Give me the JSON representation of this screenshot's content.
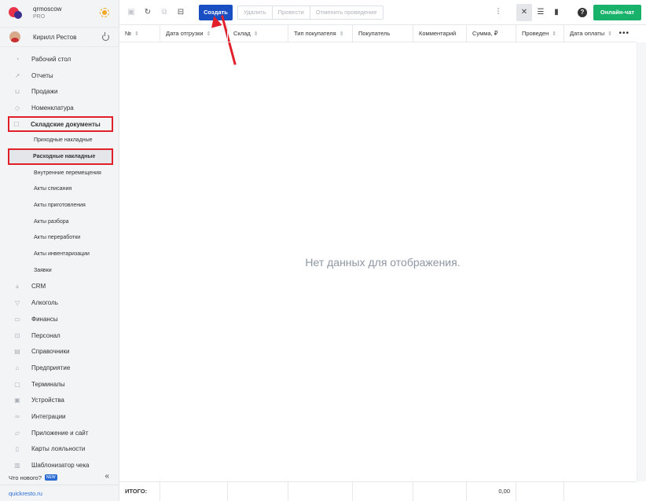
{
  "brand": {
    "name": "qrmoscow",
    "plan": "PRO"
  },
  "user": {
    "name": "Кирилл Рестов"
  },
  "sidebar": {
    "items": [
      {
        "label": "Рабочий стол",
        "icon": "gauge-icon"
      },
      {
        "label": "Отчеты",
        "icon": "chart-icon"
      },
      {
        "label": "Продажи",
        "icon": "basket-icon"
      },
      {
        "label": "Номенклатура",
        "icon": "tag-icon"
      },
      {
        "label": "Складские документы",
        "icon": "box-icon"
      }
    ],
    "sub_items": [
      "Приходные накладные",
      "Расходные накладные",
      "Внутренние перемещения",
      "Акты списания",
      "Акты приготовления",
      "Акты разбора",
      "Акты переработки",
      "Акты инвентаризации",
      "Заявки"
    ],
    "items2": [
      {
        "label": "CRM",
        "icon": "crm-icon"
      },
      {
        "label": "Алкоголь",
        "icon": "glass-icon"
      },
      {
        "label": "Финансы",
        "icon": "wallet-icon"
      },
      {
        "label": "Персонал",
        "icon": "people-icon"
      },
      {
        "label": "Справочники",
        "icon": "book-icon"
      },
      {
        "label": "Предприятие",
        "icon": "store-icon"
      },
      {
        "label": "Терминалы",
        "icon": "terminal-icon"
      },
      {
        "label": "Устройства",
        "icon": "printer-icon"
      },
      {
        "label": "Интеграции",
        "icon": "link-icon"
      },
      {
        "label": "Приложение и сайт",
        "icon": "app-icon"
      },
      {
        "label": "Карты лояльности",
        "icon": "card-icon"
      },
      {
        "label": "Шаблонизатор чека",
        "icon": "receipt-icon"
      }
    ],
    "whats_new": "Что нового?",
    "new_badge": "NEW",
    "footer_link": "quickresto.ru"
  },
  "toolbar": {
    "create": "Создать",
    "delete": "Удалить",
    "post": "Провести",
    "unpost": "Отменить проведение",
    "chat": "Онлайн-чат"
  },
  "table": {
    "columns": [
      "№",
      "Дата отгрузки",
      "Склад",
      "Тип покупателя",
      "Покупатель",
      "Комментарий",
      "Сумма, ₽",
      "Проведен",
      "Дата оплаты"
    ],
    "empty": "Нет данных для отображения.",
    "total_label": "ИТОГО:",
    "total_sum": "0,00"
  },
  "colors": {
    "create_button": "#1a4fc4",
    "chat_button": "#18b26b",
    "highlight": "#e1202a"
  }
}
